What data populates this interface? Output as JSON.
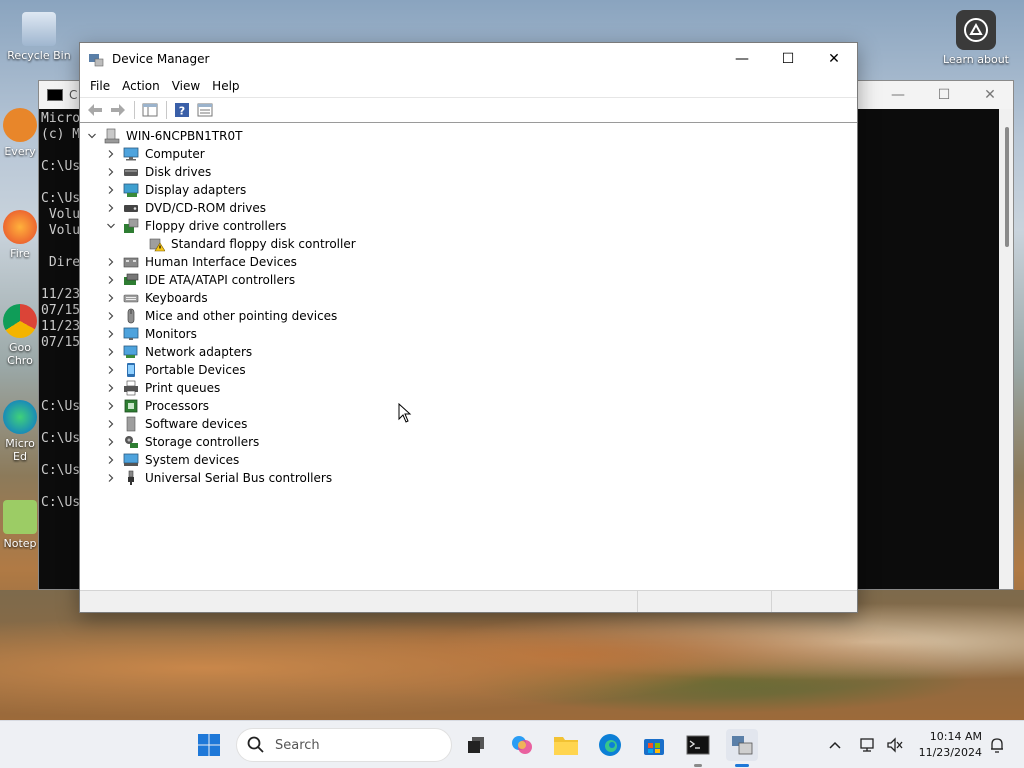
{
  "desktop": {
    "icons": [
      {
        "label": "Recycle Bin"
      },
      {
        "label": "Every"
      },
      {
        "label": "Fire"
      },
      {
        "label": "Goo Chro"
      },
      {
        "label": "Micro Ed"
      },
      {
        "label": "Notep"
      },
      {
        "label": "Learn about"
      }
    ]
  },
  "console": {
    "title": "C",
    "lines": [
      "Micro",
      "(c) M",
      "",
      "C:\\Us",
      "",
      "C:\\Us",
      " Volu",
      " Volu",
      "",
      " Dire",
      "",
      "11/23",
      "07/15",
      "11/23",
      "07/15",
      "",
      "",
      "",
      "C:\\Us",
      "",
      "C:\\Us",
      "",
      "C:\\Us",
      "",
      "C:\\Us"
    ]
  },
  "window": {
    "title": "Device Manager",
    "controls": {
      "minimize": "—",
      "maximize": "☐",
      "close": "✕"
    }
  },
  "menu": [
    "File",
    "Action",
    "View",
    "Help"
  ],
  "tree": {
    "root": "WIN-6NCPBN1TR0T",
    "items": [
      {
        "label": "Computer",
        "icon": "computer-icon",
        "expanded": false
      },
      {
        "label": "Disk drives",
        "icon": "disk-drive-icon",
        "expanded": false
      },
      {
        "label": "Display adapters",
        "icon": "display-adapter-icon",
        "expanded": false
      },
      {
        "label": "DVD/CD-ROM drives",
        "icon": "dvd-drive-icon",
        "expanded": false
      },
      {
        "label": "Floppy drive controllers",
        "icon": "floppy-controller-icon",
        "expanded": true
      },
      {
        "label": "Standard floppy disk controller",
        "icon": "warning-device-icon",
        "child": true
      },
      {
        "label": "Human Interface Devices",
        "icon": "hid-icon",
        "expanded": false
      },
      {
        "label": "IDE ATA/ATAPI controllers",
        "icon": "ide-controller-icon",
        "expanded": false
      },
      {
        "label": "Keyboards",
        "icon": "keyboard-icon",
        "expanded": false
      },
      {
        "label": "Mice and other pointing devices",
        "icon": "mouse-icon",
        "expanded": false
      },
      {
        "label": "Monitors",
        "icon": "monitor-icon",
        "expanded": false
      },
      {
        "label": "Network adapters",
        "icon": "network-adapter-icon",
        "expanded": false
      },
      {
        "label": "Portable Devices",
        "icon": "portable-device-icon",
        "expanded": false
      },
      {
        "label": "Print queues",
        "icon": "printer-icon",
        "expanded": false
      },
      {
        "label": "Processors",
        "icon": "processor-icon",
        "expanded": false
      },
      {
        "label": "Software devices",
        "icon": "software-device-icon",
        "expanded": false
      },
      {
        "label": "Storage controllers",
        "icon": "storage-controller-icon",
        "expanded": false
      },
      {
        "label": "System devices",
        "icon": "system-device-icon",
        "expanded": false
      },
      {
        "label": "Universal Serial Bus controllers",
        "icon": "usb-icon",
        "expanded": false
      }
    ]
  },
  "taskbar": {
    "search_placeholder": "Search",
    "time": "10:14 AM",
    "date": "11/23/2024"
  }
}
